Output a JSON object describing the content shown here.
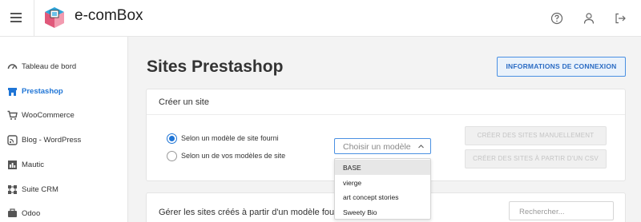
{
  "app": {
    "brand": "e-comBox"
  },
  "header": {
    "icons": [
      "help-icon",
      "user-icon",
      "logout-icon"
    ]
  },
  "sidebar": {
    "items": [
      {
        "label": "Tableau de bord",
        "icon": "dashboard-icon"
      },
      {
        "label": "Prestashop",
        "icon": "shop-icon",
        "active": true
      },
      {
        "label": "WooCommerce",
        "icon": "cart-icon"
      },
      {
        "label": "Blog - WordPress",
        "icon": "wordpress-icon"
      },
      {
        "label": "Mautic",
        "icon": "chart-icon"
      },
      {
        "label": "Suite CRM",
        "icon": "crm-icon"
      },
      {
        "label": "Odoo",
        "icon": "odoo-icon"
      }
    ]
  },
  "main": {
    "title": "Sites Prestashop",
    "info_button": "INFORMATIONS DE CONNEXION",
    "create": {
      "title": "Créer un site",
      "radio_provided": "Selon un modèle de site fourni",
      "radio_own": "Selon un de vos modèles de site",
      "select_placeholder": "Choisir un modèle",
      "options": [
        "BASE",
        "vierge",
        "art concept stories",
        "Sweety Bio"
      ],
      "btn_manual": "CRÉER DES SITES MANUELLEMENT",
      "btn_csv": "CRÉER DES SITES À PARTIR D'UN CSV"
    },
    "manage": {
      "title": "Gérer les sites créés à partir d'un modèle fourni",
      "search_placeholder": "Rechercher..."
    }
  },
  "colors": {
    "accent": "#1f75d6",
    "border_accent": "#4a90e2"
  }
}
